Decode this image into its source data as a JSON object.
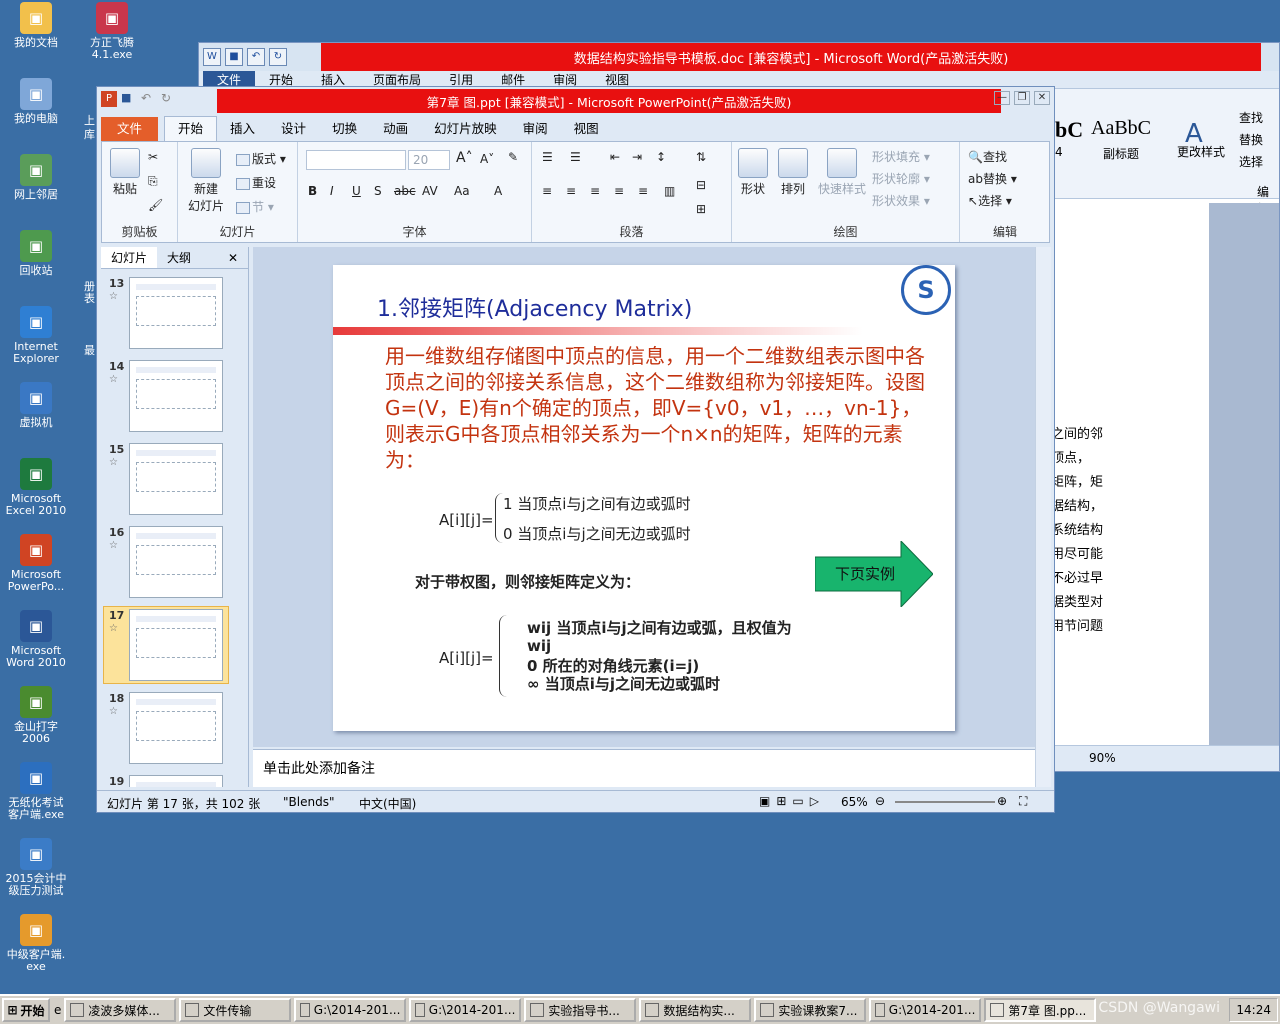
{
  "desktop": {
    "icons": [
      {
        "label": "我的文档",
        "icon": "folder-icon",
        "color": "#f2c04b"
      },
      {
        "label": "方正飞腾\n4.1.exe",
        "icon": "app-icon",
        "color": "#c9364b"
      },
      {
        "label": "我的电脑",
        "icon": "computer-icon",
        "color": "#7fa7d8"
      },
      {
        "label": "网上邻居",
        "icon": "network-icon",
        "color": "#5a9d5a"
      },
      {
        "label": "回收站",
        "icon": "recycle-bin-icon",
        "color": "#4e9a4e"
      },
      {
        "label": "Internet\nExplorer",
        "icon": "ie-icon",
        "color": "#2f7fd3"
      },
      {
        "label": "虚拟机",
        "icon": "vm-icon",
        "color": "#3a78c4"
      },
      {
        "label": "Microsoft\nExcel 2010",
        "icon": "excel-icon",
        "color": "#1e7a3e"
      },
      {
        "label": "Microsoft\nPowerPo...",
        "icon": "powerpoint-icon",
        "color": "#d04423"
      },
      {
        "label": "Microsoft\nWord 2010",
        "icon": "word-icon",
        "color": "#2b5797"
      },
      {
        "label": "金山打字\n2006",
        "icon": "typing-icon",
        "color": "#4a8b2f"
      },
      {
        "label": "无纸化考试\n客户端.exe",
        "icon": "exam-icon",
        "color": "#2c6fbf"
      },
      {
        "label": "2015会计中\n级压力测试",
        "icon": "test-icon",
        "color": "#3b7cc7"
      },
      {
        "label": "中级客户端.\nexe",
        "icon": "client-icon",
        "color": "#e59a2c"
      }
    ],
    "partial_labels": [
      "上",
      "库",
      "册",
      "表",
      "最"
    ]
  },
  "word": {
    "title": "数据结构实验指导书模板.doc [兼容模式] - Microsoft Word(产品激活失败)",
    "tabs": [
      "文件",
      "开始",
      "插入",
      "页面布局",
      "引用",
      "邮件",
      "审阅",
      "视图"
    ],
    "styles": [
      "bC",
      "AaBbC",
      "副标题",
      "4",
      "更改样式"
    ],
    "editing": [
      "查找",
      "替换",
      "选择",
      "编辑"
    ],
    "doc_lines": [
      "之间的邻",
      "顶点，",
      "矩阵，矩",
      "",
      "据结构，",
      "系统结构",
      "用尽可能",
      "不必过早",
      "",
      "",
      "据类型对",
      "用节问题"
    ],
    "zoom": "90%"
  },
  "ppt": {
    "title": "第7章 图.ppt [兼容模式] - Microsoft PowerPoint(产品激活失败)",
    "tabs": [
      "文件",
      "开始",
      "插入",
      "设计",
      "切换",
      "动画",
      "幻灯片放映",
      "审阅",
      "视图"
    ],
    "ribbon": {
      "clipboard": {
        "name": "剪贴板",
        "paste": "粘贴"
      },
      "slides": {
        "name": "幻灯片",
        "new_slide": "新建\n幻灯片",
        "layout": "版式",
        "reset": "重设",
        "section": "节"
      },
      "font": {
        "name": "字体",
        "size": "20"
      },
      "paragraph": {
        "name": "段落"
      },
      "drawing": {
        "name": "绘图",
        "shape": "形状",
        "arrange": "排列",
        "quick_styles": "快速样式",
        "fill": "形状填充",
        "outline": "形状轮廓",
        "effect": "形状效果"
      },
      "editing": {
        "name": "编辑",
        "find": "查找",
        "replace": "替换",
        "select": "选择"
      }
    },
    "pane_tabs": [
      "幻灯片",
      "大纲"
    ],
    "thumbnails": [
      "13",
      "14",
      "15",
      "16",
      "17",
      "18",
      "19"
    ],
    "selected_thumb": "17",
    "slide": {
      "title": "1.邻接矩阵(Adjacency Matrix)",
      "body": "用一维数组存储图中顶点的信息，用一个二维数组表示图中各顶点之间的邻接关系信息，这个二维数组称为邻接矩阵。设图G=(V，E)有n个确定的顶点，即V={v0，v1，…，vn-1}，则表示G中各顶点相邻关系为一个n×n的矩阵，矩阵的元素为：",
      "a1_lhs": "A[i][j]=",
      "a1_case1": "1 当顶点i与j之间有边或弧时",
      "a1_case2": "0 当顶点i与j之间无边或弧时",
      "next_button": "下页实例",
      "weighted_intro": "对于带权图，则邻接矩阵定义为：",
      "a2_lhs": "A[i][j]=",
      "a2_case1": "wij    当顶点i与j之间有边或弧，且权值为",
      "a2_case1b": "wij",
      "a2_case2": "0     所在的对角线元素(i=j)",
      "a2_case3": "∞   当顶点i与j之间无边或弧时"
    },
    "notes_placeholder": "单击此处添加备注",
    "status": {
      "slide_info": "幻灯片 第 17 张，共 102 张",
      "theme": "\"Blends\"",
      "language": "中文(中国)",
      "zoom": "65%"
    }
  },
  "taskbar": {
    "start": "开始",
    "buttons": [
      {
        "label": "凌波多媒体...",
        "active": false
      },
      {
        "label": "文件传输",
        "active": false
      },
      {
        "label": "G:\\2014-201...",
        "active": false
      },
      {
        "label": "G:\\2014-201...",
        "active": false
      },
      {
        "label": "实验指导书...",
        "active": false
      },
      {
        "label": "数据结构实...",
        "active": false
      },
      {
        "label": "实验课教案7...",
        "active": false
      },
      {
        "label": "G:\\2014-201...",
        "active": false
      },
      {
        "label": "第7章 图.pp...",
        "active": true
      }
    ],
    "clock": "14:24",
    "watermark": "CSDN @Wangawi"
  }
}
